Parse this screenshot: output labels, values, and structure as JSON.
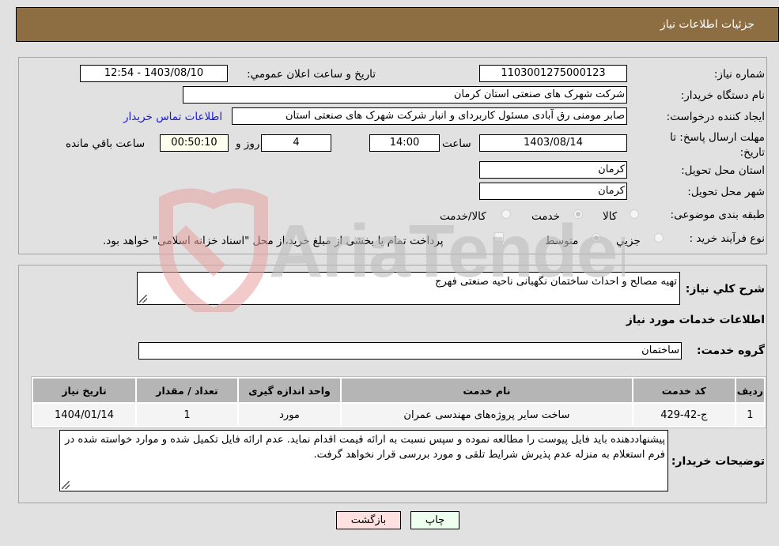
{
  "header": {
    "title": "جزئیات اطلاعات نیاز"
  },
  "form": {
    "need_number": {
      "label": "شماره نیاز:",
      "value": "1103001275000123"
    },
    "announce_datetime": {
      "label": "تاریخ و ساعت اعلان عمومي:",
      "value": "1403/08/10 - 12:54"
    },
    "buyer_org": {
      "label": "نام دستگاه خریدار:",
      "value": "شرکت شهرک های صنعتی استان کرمان"
    },
    "requester": {
      "label": "ایجاد کننده درخواست:",
      "value": "صابر مومنی رق آبادی مسئول کاربردای و انبار شرکت شهرک های صنعتی استان",
      "contact_link": "اطلاعات تماس خریدار"
    },
    "deadline": {
      "label": "مهلت ارسال پاسخ: تا تاریخ:",
      "date": "1403/08/14",
      "time_label": "ساعت",
      "time": "14:00",
      "days": "4",
      "days_label": "روز و",
      "remaining": "00:50:10",
      "remaining_label": "ساعت باقي مانده"
    },
    "province": {
      "label": "استان محل تحویل:",
      "value": "کرمان"
    },
    "city": {
      "label": "شهر محل تحویل:",
      "value": "کرمان"
    },
    "category": {
      "label": "طبقه بندی موضوعی:",
      "options": [
        "کالا",
        "خدمت",
        "کالا/خدمت"
      ],
      "selected": "خدمت"
    },
    "purchase_type": {
      "label": "نوع فرآیند خرید :",
      "options": [
        "جزیي",
        "متوسط"
      ],
      "selected": "متوسط",
      "treasury_note": "پرداخت تمام یا بخشی از مبلغ خرید،از محل \"اسناد خزانه اسلامی\" خواهد بود."
    }
  },
  "details": {
    "summary_label": "شرح کلي نیاز:",
    "summary": "تهیه مصالح و احداث ساختمان نگهبانی ناحیه صنعتی فهرج",
    "services_heading": "اطلاعات خدمات مورد نیاز",
    "service_group_label": "گروه خدمت:",
    "service_group": "ساختمان",
    "table": {
      "headers": [
        "ردیف",
        "کد خدمت",
        "نام خدمت",
        "واحد اندازه گیری",
        "تعداد / مقدار",
        "تاریخ نیاز"
      ],
      "rows": [
        [
          "1",
          "ج-42-429",
          "ساخت سایر پروژه‌های مهندسی عمران",
          "مورد",
          "1",
          "1404/01/14"
        ]
      ]
    },
    "buyer_notes_label": "توضیحات خریدار:",
    "buyer_notes": "پیشنهاددهنده باید فایل پیوست را مطالعه نموده و سپس نسبت به ارائه قیمت اقدام نماید. عدم ارائه فایل تکمیل شده و موارد خواسته شده در فرم استعلام به منزله عدم پذیرش شرایط تلقی و مورد بررسی قرار نخواهد گرفت."
  },
  "buttons": {
    "print": "چاپ",
    "back": "بازگشت"
  },
  "watermark": {
    "text": "AriaTender.neT"
  },
  "colors": {
    "header_bg": "#8d6e43",
    "print_bg": "#efffef",
    "back_bg": "#ffe1e1",
    "link": "#1a1ad6"
  }
}
